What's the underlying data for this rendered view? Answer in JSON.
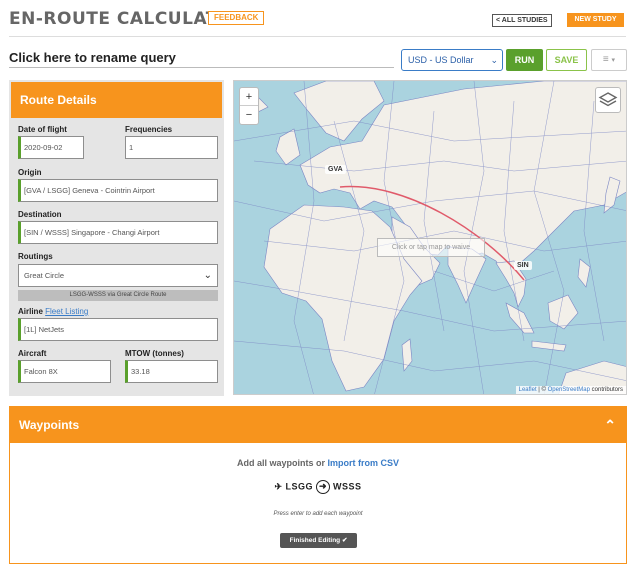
{
  "header": {
    "title": "EN-ROUTE CALCULATOR",
    "feedback_label": "FEEDBACK",
    "all_studies_label": "< ALL STUDIES",
    "new_study_label": "NEW STUDY"
  },
  "toolbar": {
    "query_name": "Click here to rename query",
    "currency": "USD - US Dollar",
    "run_label": "RUN",
    "save_label": "SAVE"
  },
  "route_details": {
    "title": "Route Details",
    "date_label": "Date of flight",
    "date_value": "2020-09-02",
    "frequencies_label": "Frequencies",
    "frequencies_value": "1",
    "origin_label": "Origin",
    "origin_value": "[GVA / LSGG] Geneva - Cointrin Airport",
    "destination_label": "Destination",
    "destination_value": "[SIN / WSSS] Singapore - Changi Airport",
    "routings_label": "Routings",
    "routings_value": "Great Circle",
    "route_note": "LSGG-WSSS via Great Circle Route",
    "airline_label": "Airline",
    "fleet_link": "Fleet Listing",
    "airline_value": "[1L] NetJets",
    "aircraft_label": "Aircraft",
    "aircraft_value": "Falcon 8X",
    "mtow_label": "MTOW (tonnes)",
    "mtow_value": "33.18"
  },
  "map": {
    "zoom_in": "+",
    "zoom_out": "−",
    "origin_tag": "GVA",
    "destination_tag": "SIN",
    "hint": "Click or tap map to waive",
    "attribution_leaflet": "Leaflet",
    "attribution_sep": " | © ",
    "attribution_osm": "OpenStreetMap",
    "attribution_tail": " contributors",
    "colors": {
      "water": "#aad3df",
      "land": "#f2efe9",
      "route": "#e05a6a"
    }
  },
  "waypoints": {
    "title": "Waypoints",
    "add_text": "Add all waypoints or",
    "import_link": "Import from CSV",
    "from_code": "LSGG",
    "to_code": "WSSS",
    "hint": "Press enter to add each waypoint",
    "finished_label": "Finished Editing ✔"
  },
  "colors": {
    "accent": "#f7941d",
    "run": "#5aa02c",
    "link": "#3a7cc7"
  },
  "icons": [
    "chevron-down-icon",
    "menu-icon",
    "layers-icon",
    "plane-icon",
    "arrow-circle-icon",
    "chevron-up-icon",
    "check-icon"
  ]
}
